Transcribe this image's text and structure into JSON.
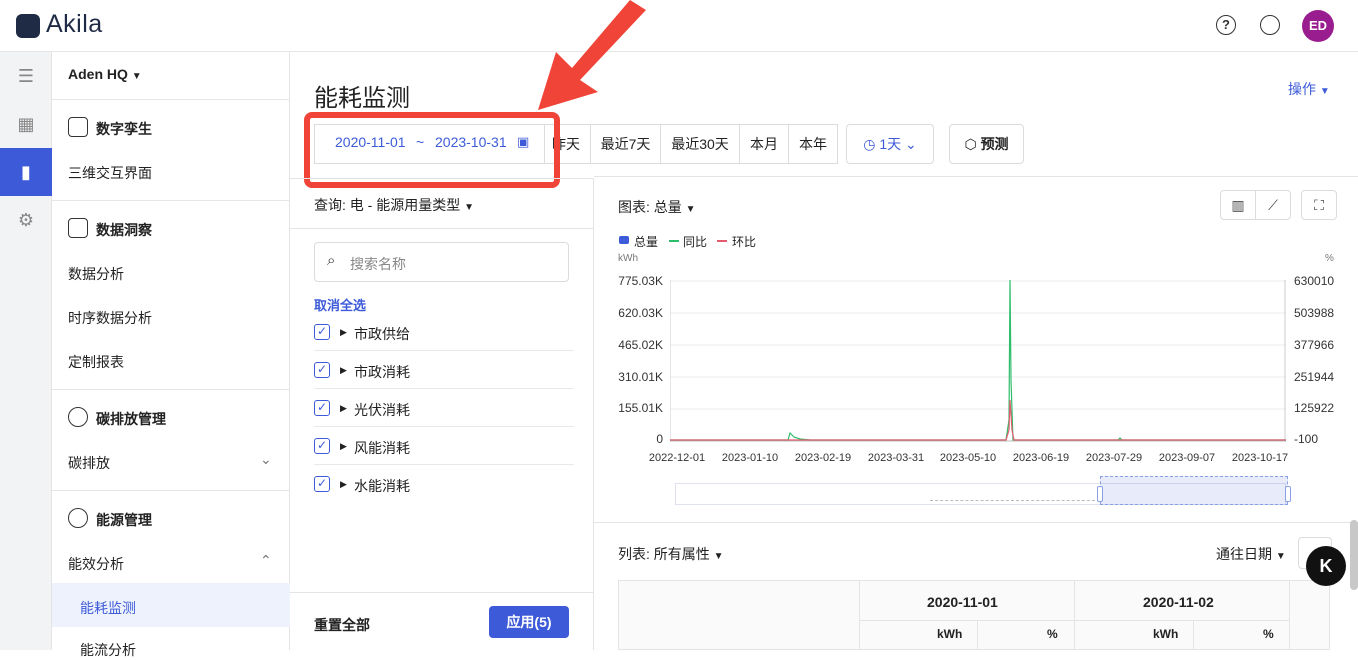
{
  "header": {
    "app_name": "Akila",
    "help_icon": "?",
    "avatar_initials": "ED"
  },
  "site": {
    "name": "Aden HQ"
  },
  "sidebar": {
    "sections": [
      {
        "title": "数字孪生",
        "items": [
          "三维交互界面"
        ]
      },
      {
        "title": "数据洞察",
        "items": [
          "数据分析",
          "时序数据分析",
          "定制报表"
        ]
      },
      {
        "title": "碳排放管理",
        "items": [
          "碳排放"
        ]
      },
      {
        "title": "能源管理",
        "items": [
          "能效分析",
          "能耗监测",
          "能流分析"
        ]
      }
    ]
  },
  "page": {
    "title": "能耗监测",
    "operations": "操作"
  },
  "toolbar": {
    "date_start": "2020-11-01",
    "date_sep": "~",
    "date_end": "2023-10-31",
    "quick": [
      "昨天",
      "最近7天",
      "最近30天",
      "本月",
      "本年"
    ],
    "interval": "1天",
    "forecast": "预测"
  },
  "filter": {
    "query_label": "查询: 电 - 能源用量类型",
    "search_placeholder": "搜索名称",
    "deselect_all": "取消全选",
    "items": [
      "市政供给",
      "市政消耗",
      "光伏消耗",
      "风能消耗",
      "水能消耗"
    ],
    "reset": "重置全部",
    "apply": "应用(5)"
  },
  "chart_panel": {
    "label": "图表: 总量"
  },
  "chart_data": {
    "type": "line",
    "legend": [
      "总量",
      "同比",
      "环比"
    ],
    "y_left_unit": "kWh",
    "y_right_unit": "%",
    "y_left_ticks": [
      "775.03K",
      "620.03K",
      "465.02K",
      "310.01K",
      "155.01K",
      "0"
    ],
    "y_right_ticks": [
      "630010",
      "503988",
      "377966",
      "251944",
      "125922",
      "-100"
    ],
    "x_ticks": [
      "2022-12-01",
      "2023-01-10",
      "2023-02-19",
      "2023-03-31",
      "2023-05-10",
      "2023-06-19",
      "2023-07-29",
      "2023-09-07",
      "2023-10-17"
    ],
    "series": [
      {
        "name": "同比",
        "color": "#2ebd6b",
        "values": [
          [
            0.4,
            0.05
          ],
          [
            0.8,
            1.0
          ],
          [
            0.71,
            0.0
          ]
        ]
      },
      {
        "name": "环比",
        "color": "#e25b6e",
        "values": [
          [
            0.8,
            0.25
          ]
        ]
      }
    ],
    "grid": true,
    "legend_position": "top-left"
  },
  "list_panel": {
    "label": "列表: 所有属性",
    "sort": "通往日期"
  },
  "table": {
    "dates": [
      "2020-11-01",
      "2020-11-02"
    ],
    "units": [
      "kWh",
      "%",
      "kWh",
      "%"
    ]
  },
  "colors": {
    "accent": "#3d5bd9",
    "highlight": "#f04438"
  }
}
